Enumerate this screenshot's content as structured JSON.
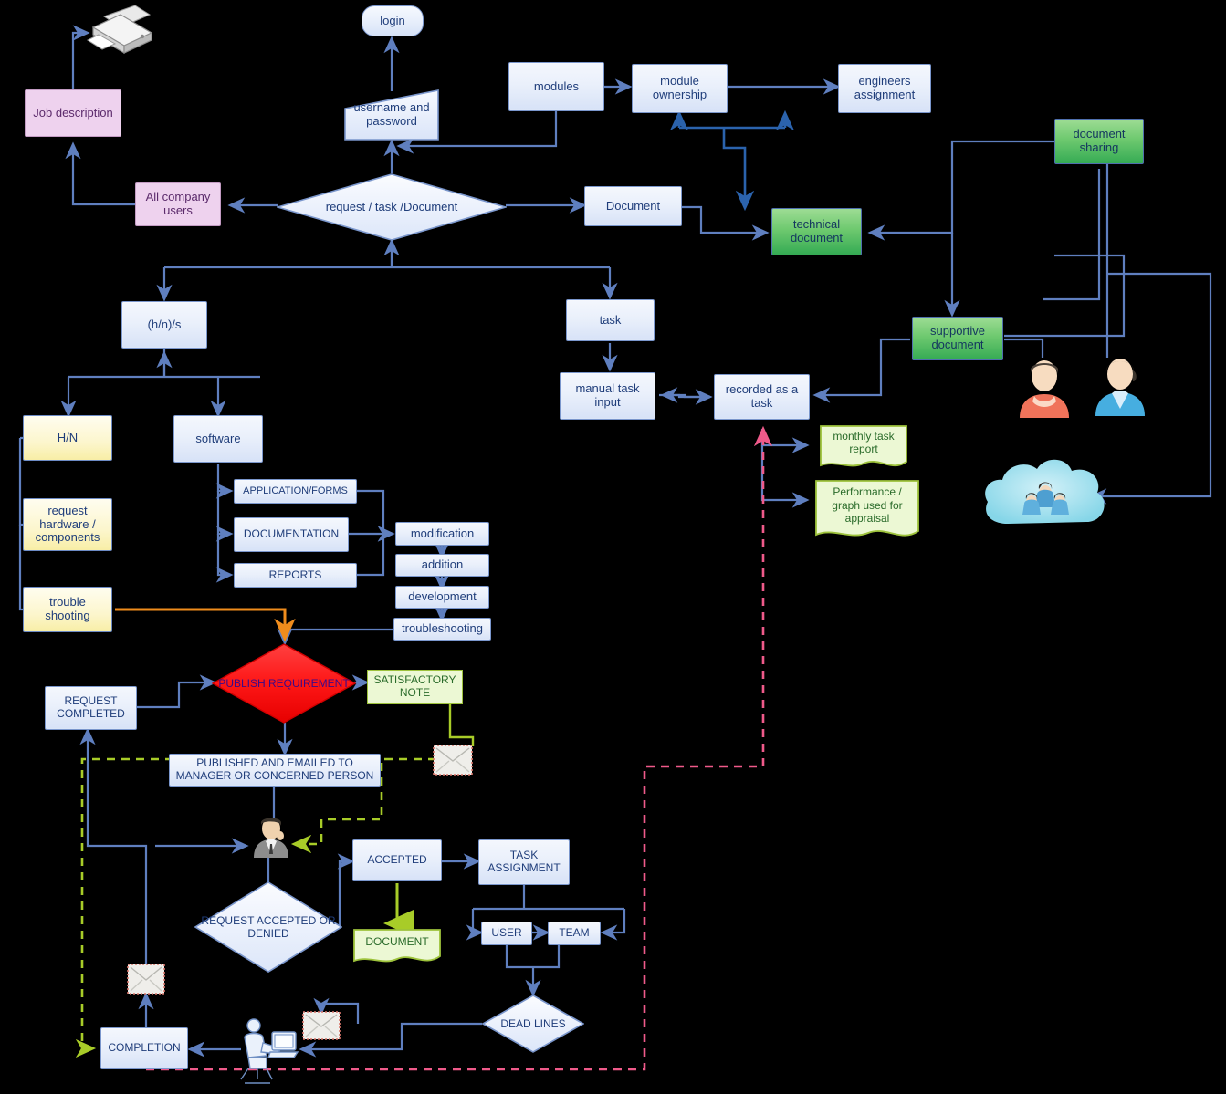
{
  "diagram": {
    "title": "Document / Task Management Workflow Flowchart",
    "colors": {
      "process_fill": "#e8effb",
      "process_border": "#7a96cc",
      "pink_fill": "#eed2ee",
      "pink_border": "#c39bc3",
      "yellow_fill": "#fcf6cd",
      "green_fill": "#6ec96f",
      "decision_red": "#ff1f1f",
      "note_green": "#ebf7d0",
      "line_blue": "#5f7fbf",
      "line_orange": "#ef8c1c",
      "line_green_dashed": "#a8cc28",
      "line_pink_dashed": "#ef5a8a",
      "text_blue": "#1f3d7a"
    },
    "nodes": {
      "job_description": "Job description",
      "all_company_users": "All company users",
      "login": "login",
      "username_password": "username and password",
      "request_task_document": "request / task /Document",
      "modules": "modules",
      "module_ownership": "module ownership",
      "engineers_assignment": "engineers assignment",
      "document": "Document",
      "technical_document": "technical document",
      "document_sharing": "document sharing",
      "supportive_document": "supportive document",
      "hns": "(h/n)/s",
      "task": "task",
      "manual_task_input": "manual task input",
      "recorded_as_a_task": "recorded as a task",
      "monthly_task_report": "monthly task report",
      "performance_graph": "Performance / graph used for appraisal",
      "hn": "H/N",
      "software": "software",
      "request_hardware": "request hardware / components",
      "trouble_shooting": "trouble shooting",
      "application_forms": "APPLICATION/FORMS",
      "documentation": "DOCUMENTATION",
      "reports": "REPORTS",
      "modification": "modification",
      "addition": "addition",
      "development": "development",
      "troubleshooting2": "troubleshooting",
      "publish_requirement": "PUBLISH REQUIREMENT",
      "satisfactory_note": "SATISFACTORY NOTE",
      "request_completed": "REQUEST COMPLETED",
      "published_emailed": "PUBLISHED AND EMAILED TO MANAGER OR CONCERNED PERSON",
      "accepted": "ACCEPTED",
      "document_note": "DOCUMENT",
      "task_assignment": "TASK ASSIGNMENT",
      "user": "USER",
      "team": "TEAM",
      "request_accepted_denied": "REQUEST ACCEPTED  OR DENIED",
      "dead_lines": "DEAD LINES",
      "completion": "COMPLETION"
    },
    "icons": {
      "printer": "printer-icon",
      "person_orange": "person-orange-icon",
      "person_blue": "person-blue-icon",
      "cloud_users": "cloud-users-icon",
      "manager": "manager-person-icon",
      "envelope_a": "envelope-icon",
      "envelope_b": "envelope-icon",
      "envelope_c": "envelope-icon",
      "worker_computer": "worker-at-computer-icon"
    }
  }
}
